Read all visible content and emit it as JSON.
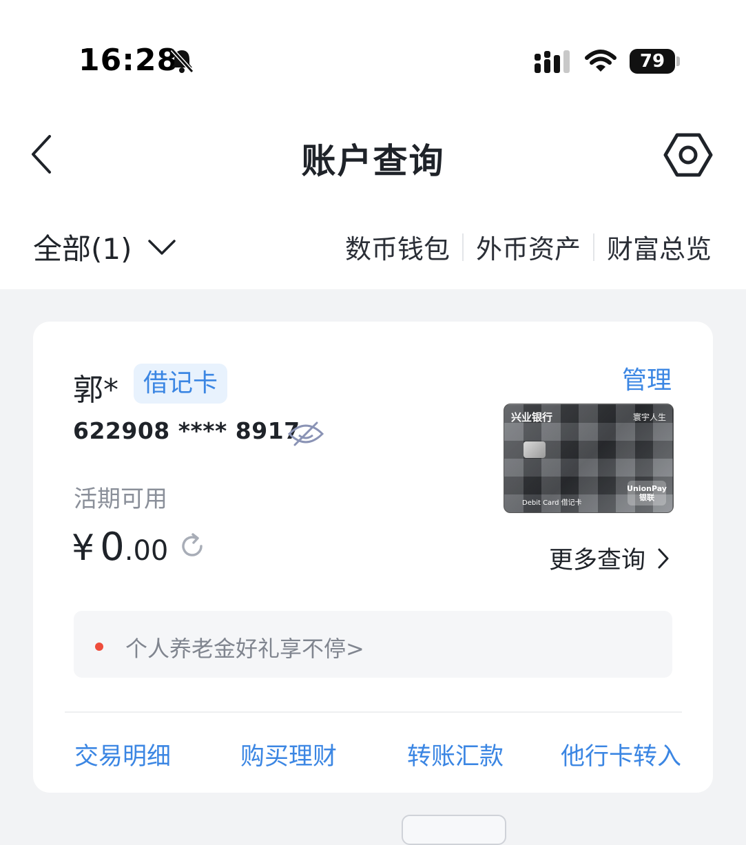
{
  "status_bar": {
    "time": "16:28",
    "battery": "79"
  },
  "nav": {
    "title": "账户查询",
    "back_icon": "chevron-left-icon",
    "settings_icon": "gear-icon"
  },
  "filter": {
    "all_label": "全部(1)",
    "quick_links": [
      "数币钱包",
      "外币资产",
      "财富总览"
    ]
  },
  "card": {
    "holder_name": "郭*",
    "card_type": "借记卡",
    "manage_label": "管理",
    "account_number": "622908 **** 8917",
    "available_label": "活期可用",
    "balance_symbol": "¥",
    "balance_int": "0",
    "balance_dec": ".00",
    "more_query_label": "更多查询",
    "card_image": {
      "bank_name": "兴业银行",
      "series": "寰宇人生",
      "debit_text": "Debit Card 借记卡",
      "union_line1": "UnionPay",
      "union_line2": "银联"
    },
    "promo_text": "个人养老金好礼享不停>",
    "actions": [
      "交易明细",
      "购买理财",
      "转账汇款",
      "他行卡转入"
    ]
  },
  "colors": {
    "accent": "#3b86e3",
    "background": "#f2f3f5",
    "promo_dot": "#ee4d3c"
  }
}
